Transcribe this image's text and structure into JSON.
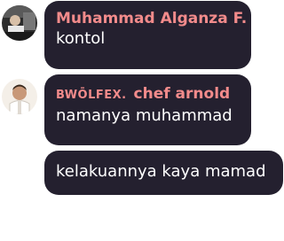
{
  "messages": [
    {
      "sender": "Muhammad Alganza F.",
      "text": "kontol",
      "name_color": "#f28b8b"
    },
    {
      "tag": "BWŌLFEX.",
      "sender": "chef arnold",
      "text": "namanya muhammad",
      "name_color": "#f28b8b"
    },
    {
      "text": "kelakuannya kaya mamad"
    }
  ],
  "colors": {
    "bubble": "#24202f",
    "name": "#f28b8b",
    "text": "#ffffff",
    "background": "#ffffff"
  }
}
